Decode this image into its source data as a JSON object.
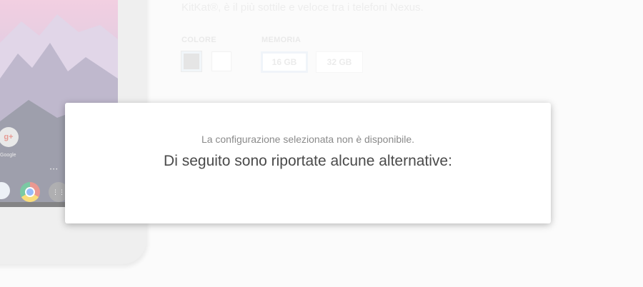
{
  "product": {
    "tagline": "KitKat®, è il più sottile e veloce tra i telefoni Nexus."
  },
  "options": {
    "color_label": "COLORE",
    "color_swatches": [
      {
        "name": "gray",
        "hex": "#cfcfcf",
        "selected": true
      },
      {
        "name": "white",
        "hex": "#ffffff",
        "selected": false
      }
    ],
    "memory_label": "MEMORIA",
    "memory_options": [
      {
        "label": "16 GB",
        "selected": true
      },
      {
        "label": "32 GB",
        "selected": false
      }
    ]
  },
  "phone": {
    "home_label": "Google",
    "icons": [
      "google-folder-icon",
      "camera-icon",
      "chrome-icon",
      "app-drawer-icon",
      "back-icon",
      "home-icon"
    ]
  },
  "modal": {
    "message": "La configurazione selezionata non è disponibile.",
    "title": "Di seguito sono riportate alcune alternative:"
  },
  "colors": {
    "page_bg": "#f8f8f8",
    "modal_bg": "#ffffff",
    "modal_title": "#4a4a4a",
    "modal_message": "#8a8a8a"
  }
}
